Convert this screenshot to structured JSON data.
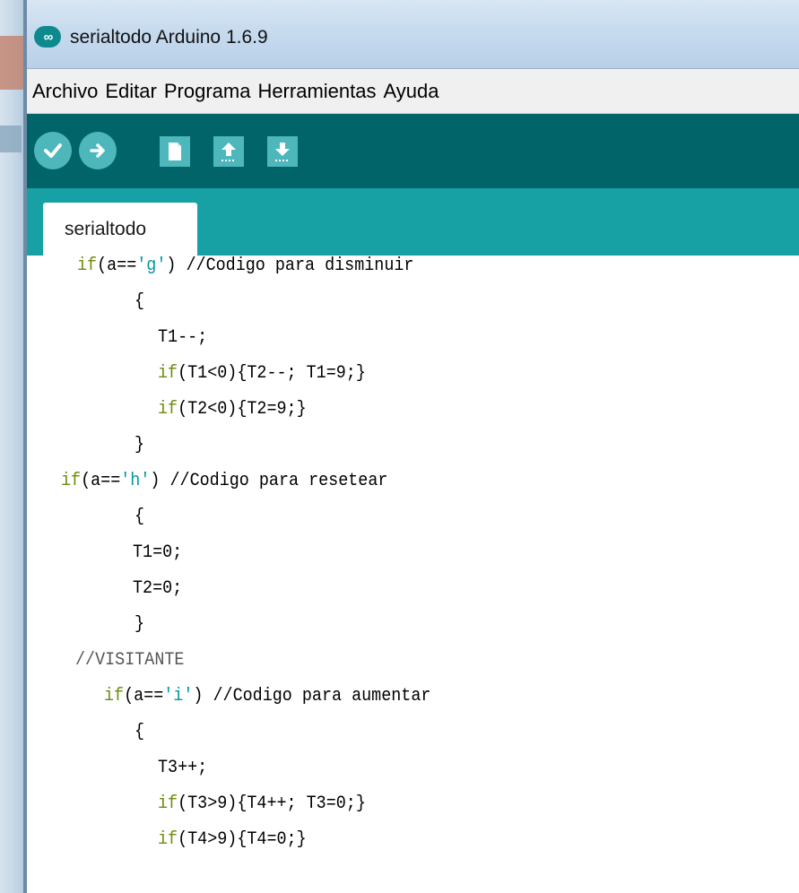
{
  "window": {
    "title": "serialtodo Arduino 1.6.9"
  },
  "menu": [
    "Archivo",
    "Editar",
    "Programa",
    "Herramientas",
    "Ayuda"
  ],
  "toolbar": {
    "buttons": [
      "verify-icon",
      "upload-icon",
      "new-icon",
      "open-icon",
      "save-icon"
    ]
  },
  "tabs": [
    {
      "label": "serialtodo"
    }
  ],
  "colors": {
    "toolbar_bg": "#006468",
    "tabbar_bg": "#17a1a5",
    "button_bg": "#4db7bb",
    "keyword": "#6c8c0c",
    "string": "#00979c"
  },
  "code": {
    "lines": [
      {
        "kw": "if",
        "pre": "(a==",
        "str": "'g'",
        "post": ") //Codigo para disminuir"
      },
      {
        "text": "{"
      },
      {
        "text": "T1--;"
      },
      {
        "kw": "if",
        "post": "(T1<0){T2--; T1=9;}"
      },
      {
        "kw": "if",
        "post": "(T2<0){T2=9;}"
      },
      {
        "text": "}"
      },
      {
        "kw": "if",
        "pre": "(a==",
        "str": "'h'",
        "post": ") //Codigo para resetear"
      },
      {
        "text": "{"
      },
      {
        "text": "T1=0;"
      },
      {
        "text": "T2=0;"
      },
      {
        "text": "}"
      },
      {
        "text": "//VISITANTE"
      },
      {
        "kw": "if",
        "pre": "(a==",
        "str": "'i'",
        "post": ") //Codigo para aumentar"
      },
      {
        "text": "{"
      },
      {
        "text": "T3++;"
      },
      {
        "kw": "if",
        "post": "(T3>9){T4++; T3=0;}"
      },
      {
        "kw": "if",
        "post": "(T4>9){T4=0;}"
      }
    ]
  }
}
